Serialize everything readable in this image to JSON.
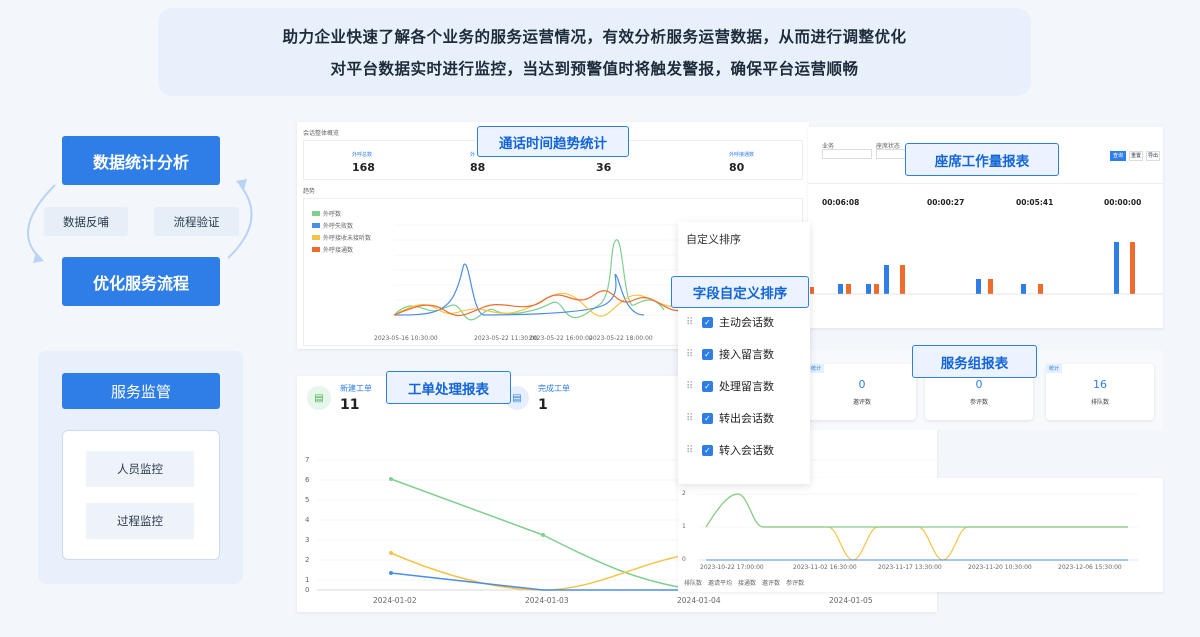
{
  "banner": {
    "line1": "助力企业快速了解各个业务的服务运营情况，有效分析服务运营数据，从而进行调整优化",
    "line2": "对平台数据实时进行监控，当达到预警值时将触发警报，确保平台运营顺畅"
  },
  "left": {
    "analysis": "数据统计分析",
    "feedback": "数据反哺",
    "verify": "流程验证",
    "optimize": "优化服务流程",
    "monitor": "服务监管",
    "staff_monitor": "人员监控",
    "process_monitor": "过程监控"
  },
  "labels": {
    "call_trend": "通话时间趋势统计",
    "seat_report": "座席工作量报表",
    "field_sort": "字段自定义排序",
    "order_report": "工单处理报表",
    "group_report": "服务组报表"
  },
  "call_card": {
    "header": "会话整体概览",
    "trend": "趋势",
    "stats": [
      {
        "label": "外呼总数",
        "value": "168"
      },
      {
        "label": "外",
        "value": "88"
      },
      {
        "label": "",
        "value": "36"
      },
      {
        "label": "外呼接通数",
        "value": "80"
      }
    ],
    "legend": [
      "外呼数",
      "外呼失败数",
      "外呼接收未接听数",
      "外呼接通数"
    ],
    "x_ticks": [
      "2023-05-16 10:30:00",
      "2023-05-22 11:30:00",
      "2023-05-22 16:00:00",
      "2023-05-22 18:00:00",
      "2023-05-16"
    ],
    "y_ticks": [
      "0",
      "3",
      "6",
      "9",
      "12",
      "15",
      "18",
      "21"
    ]
  },
  "seat_card": {
    "filters": [
      "业务",
      "座席状态"
    ],
    "buttons": [
      "查询",
      "重置",
      "导出"
    ],
    "metrics": [
      {
        "label": "",
        "value": "00:06:08"
      },
      {
        "label": "",
        "value": "00:00:27"
      },
      {
        "label": "",
        "value": "00:05:41"
      },
      {
        "label": "",
        "value": "00:00:00"
      }
    ]
  },
  "sort_panel": {
    "title": "自定义排序",
    "items": [
      "主动会话数",
      "接入留言数",
      "处理留言数",
      "转出会话数",
      "转入会话数"
    ]
  },
  "order_card": {
    "new_label": "新建工单",
    "new_value": "11",
    "done_label": "完成工单",
    "done_value": "1",
    "x_ticks": [
      "2024-01-02",
      "2024-01-03",
      "2024-01-04",
      "2024-01-05"
    ],
    "y_ticks": [
      "0",
      "1",
      "2",
      "3",
      "4",
      "5",
      "6",
      "7"
    ]
  },
  "group_card": {
    "tag": "统计",
    "cells": [
      {
        "value": "0",
        "label": "邀评数"
      },
      {
        "value": "0",
        "label": "参评数"
      },
      {
        "value": "16",
        "label": "排队数"
      }
    ]
  },
  "trend2": {
    "x_ticks": [
      "2023-10-22 17:00:00",
      "2023-11-02 16:30:00",
      "2023-11-17 13:30:00",
      "2023-11-20 10:30:00",
      "2023-12-06 15:30:00"
    ],
    "y_ticks": [
      "0",
      "1",
      "2"
    ],
    "legend": [
      "排队数",
      "邀请平均",
      "接通数",
      "邀评数",
      "参评数"
    ]
  },
  "colors": {
    "accent": "#2f7ee8",
    "green": "#7fcf8f",
    "yellow": "#f6c445",
    "orange": "#f06a2e",
    "blue_line": "#4b8de8"
  }
}
